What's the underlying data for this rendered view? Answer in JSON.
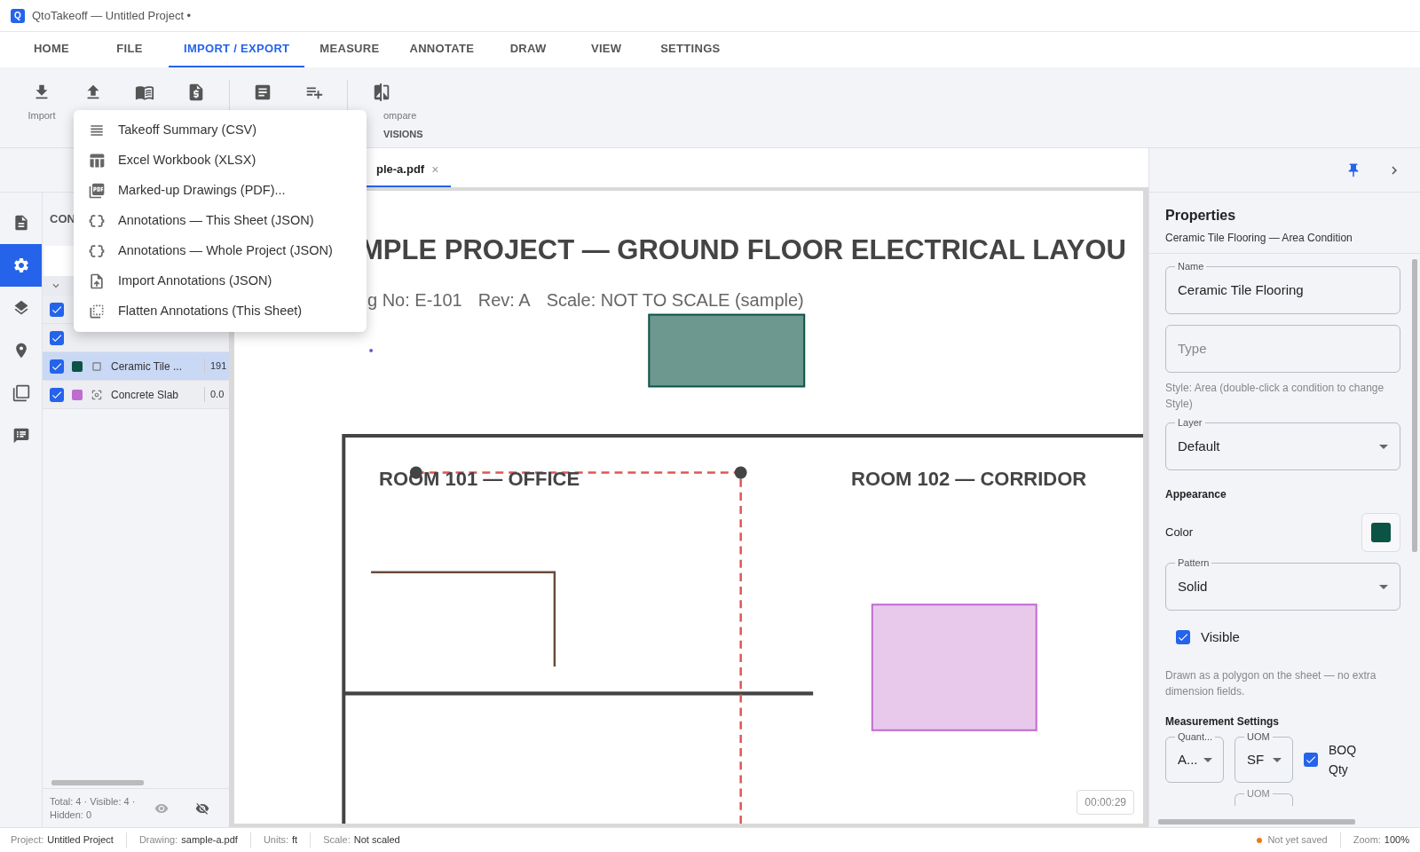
{
  "window": {
    "logo": "Q",
    "title": "QtoTakeoff — Untitled Project •"
  },
  "menu_tabs": [
    {
      "label": "HOME",
      "selected": false
    },
    {
      "label": "FILE",
      "selected": false
    },
    {
      "label": "IMPORT / EXPORT",
      "selected": true
    },
    {
      "label": "MEASURE",
      "selected": false
    },
    {
      "label": "ANNOTATE",
      "selected": false
    },
    {
      "label": "DRAW",
      "selected": false
    },
    {
      "label": "VIEW",
      "selected": false
    },
    {
      "label": "SETTINGS",
      "selected": false
    }
  ],
  "ribbon": {
    "buttons": [
      {
        "kind": "download",
        "label": "Import"
      },
      {
        "kind": "upload"
      },
      {
        "kind": "book"
      },
      {
        "kind": "invoice"
      },
      {
        "kind": "article"
      },
      {
        "kind": "list-add"
      },
      {
        "kind": "compare",
        "label": "ompare"
      }
    ],
    "group_label": "VISIONS"
  },
  "export_menu": [
    {
      "kind": "lines",
      "label": "Takeoff Summary (CSV)"
    },
    {
      "kind": "table",
      "label": "Excel Workbook (XLSX)"
    },
    {
      "kind": "pdf",
      "label": "Marked-up Drawings (PDF)..."
    },
    {
      "kind": "braces",
      "label": "Annotations — This Sheet (JSON)"
    },
    {
      "kind": "braces",
      "label": "Annotations — Whole Project (JSON)"
    },
    {
      "kind": "file-upload",
      "label": "Import Annotations (JSON)"
    },
    {
      "kind": "flatten",
      "label": "Flatten Annotations (This Sheet)"
    }
  ],
  "document_tabs": [
    {
      "label": "ple-a.pdf",
      "close": "×",
      "selected": true
    }
  ],
  "left_rail": [
    {
      "kind": "document",
      "selected": false
    },
    {
      "kind": "settings",
      "selected": true
    },
    {
      "kind": "layers",
      "selected": false
    },
    {
      "kind": "pin",
      "selected": false
    },
    {
      "kind": "pages",
      "selected": false
    },
    {
      "kind": "notes",
      "selected": false
    }
  ],
  "conditions_panel": {
    "header": "CON",
    "rows": [
      {
        "checked": true,
        "selected": false
      },
      {
        "checked": true,
        "selected": false
      },
      {
        "checked": true,
        "selected": true,
        "color": "#0b5345",
        "kind": "area",
        "name": "Ceramic Tile ...",
        "value": "191"
      },
      {
        "checked": true,
        "selected": false,
        "color": "#c06bd0",
        "kind": "target",
        "name": "Concrete Slab",
        "value": "0.0"
      }
    ],
    "footer": "Total: 4 · Visible: 4 · Hidden: 0"
  },
  "sheet": {
    "title": "MPLE PROJECT — GROUND FLOOR ELECTRICAL LAYOU",
    "subtitle": [
      "g No: E-101",
      "Rev: A",
      "Scale: NOT TO SCALE (sample)"
    ],
    "rooms": [
      "ROOM 101 — OFFICE",
      "ROOM 102 — CORRIDOR"
    ],
    "timer": "00:00:29"
  },
  "properties": {
    "title": "Properties",
    "subtitle": "Ceramic Tile Flooring — Area Condition",
    "name": {
      "label": "Name",
      "value": "Ceramic Tile Flooring"
    },
    "type": {
      "placeholder": "Type"
    },
    "style_note": "Style: Area (double-click a condition to change Style)",
    "layer": {
      "label": "Layer",
      "value": "Default"
    },
    "appearance": "Appearance",
    "color_label": "Color",
    "color": "#0b5345",
    "pattern": {
      "label": "Pattern",
      "value": "Solid"
    },
    "visible": {
      "label": "Visible",
      "checked": true
    },
    "note": "Drawn as a polygon on the sheet — no extra dimension fields.",
    "measurement": "Measurement Settings",
    "quantity": {
      "label": "Quant...",
      "value": "A..."
    },
    "uom": {
      "label": "UOM",
      "value": "SF"
    },
    "boq": {
      "label": "BOQ Qty",
      "checked": true
    },
    "next_label": "UOM"
  },
  "status_bar": {
    "items": [
      {
        "label": "Project:",
        "value": "Untitled Project"
      },
      {
        "label": "Drawing:",
        "value": "sample-a.pdf"
      },
      {
        "label": "Units:",
        "value": "ft"
      },
      {
        "label": "Scale:",
        "value": "Not scaled"
      }
    ],
    "saved": "Not yet saved",
    "zoom": {
      "label": "Zoom:",
      "value": "100%"
    }
  }
}
